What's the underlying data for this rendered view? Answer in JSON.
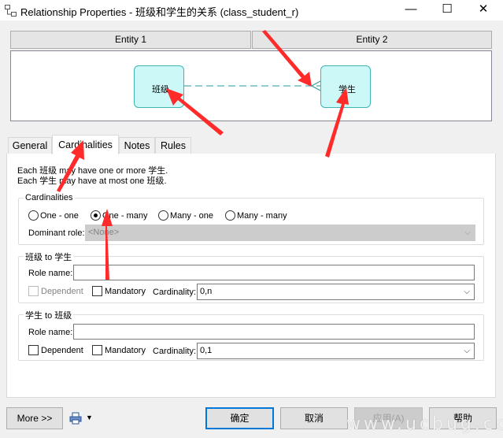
{
  "window": {
    "title": "Relationship Properties - 班级和学生的关系 (class_student_r)",
    "minimize": "—",
    "maximize": "☐",
    "close": "✕"
  },
  "entities": {
    "header1": "Entity 1",
    "header2": "Entity 2",
    "entity1_name": "班级",
    "entity2_name": "学生"
  },
  "tabs": [
    {
      "label": "General"
    },
    {
      "label": "Cardinalities"
    },
    {
      "label": "Notes"
    },
    {
      "label": "Rules"
    }
  ],
  "summary": {
    "line1": "Each 班级 may have one or more 学生.",
    "line2": "Each 学生 may have at most one 班级."
  },
  "cardinalities": {
    "label": "Cardinalities",
    "options": [
      "One - one",
      "One - many",
      "Many - one",
      "Many - many"
    ],
    "selected": "One - many",
    "dominant_label": "Dominant role:",
    "dominant_value": "<None>"
  },
  "role1": {
    "title": "班级 to 学生",
    "role_label": "Role name:",
    "role_value": "",
    "dependent": "Dependent",
    "mandatory": "Mandatory",
    "cardinality_label": "Cardinality:",
    "cardinality_value": "0,n"
  },
  "role2": {
    "title": "学生 to 班级",
    "role_label": "Role name:",
    "role_value": "",
    "dependent": "Dependent",
    "mandatory": "Mandatory",
    "cardinality_label": "Cardinality:",
    "cardinality_value": "0,1"
  },
  "footer": {
    "more": "More >>",
    "ok": "确定",
    "cancel": "取消",
    "apply": "应用(A)",
    "help": "帮助"
  },
  "watermark": "www.ucbug.cc",
  "colors": {
    "entity_fill": "#cdf8f8",
    "entity_border": "#3fb4b4",
    "annotation_arrow": "#ff2b2b",
    "focus_blue": "#0078d7"
  }
}
